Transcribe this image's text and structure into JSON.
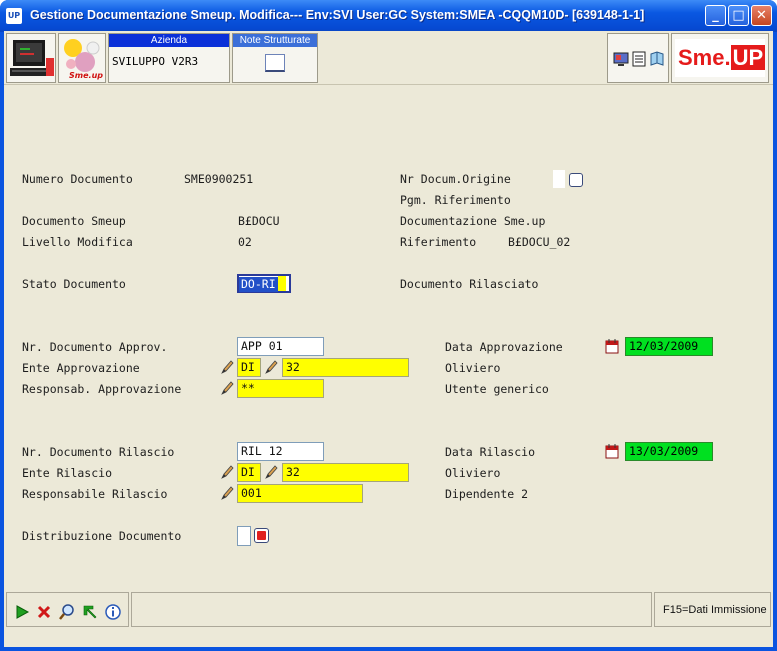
{
  "window": {
    "title": "Gestione Documentazione Smeup.  Modifica--- Env:SVI User:GC System:SMEA -CQQM10D- [639148-1-1]",
    "app_icon_text": "UP",
    "minimize": "_",
    "maximize": "□",
    "close": "✕"
  },
  "toolbar": {
    "azienda_header": "Azienda",
    "azienda_value": "SVILUPPO V2R3",
    "note_header": "Note Strutturate",
    "logo_text": "Sme.",
    "logo_up": "UP",
    "logo_small": "Sme.up"
  },
  "form": {
    "numero_documento_label": "Numero Documento",
    "numero_documento_value": "SME0900251",
    "documento_smeup_label": "Documento Smeup",
    "documento_smeup_value": "B£DOCU",
    "livello_modifica_label": "Livello Modifica",
    "livello_modifica_value": "02",
    "nr_docum_origine_label": "Nr Docum.Origine",
    "pgm_riferimento_label": "Pgm. Riferimento",
    "documentazione_label": "Documentazione Sme.up",
    "riferimento_label": "Riferimento",
    "riferimento_value": "B£DOCU_02",
    "stato_documento_label": "Stato Documento",
    "stato_documento_value": "DO-RI",
    "stato_documento_desc": "Documento Rilasciato",
    "approv": {
      "nr_label": "Nr. Documento Approv.",
      "nr_value": "APP 01",
      "ente_label": "Ente Approvazione",
      "ente_code": "DI",
      "ente_value": "32",
      "resp_label": "Responsab. Approvazione",
      "resp_value": "**",
      "data_label": "Data Approvazione",
      "data_value": "12/03/2009",
      "ente_desc": "Oliviero",
      "resp_desc": "Utente generico"
    },
    "rilascio": {
      "nr_label": "Nr. Documento Rilascio",
      "nr_value": "RIL 12",
      "ente_label": "Ente Rilascio",
      "ente_code": "DI",
      "ente_value": "32",
      "resp_label": "Responsabile Rilascio",
      "resp_value": "001",
      "data_label": "Data Rilascio",
      "data_value": "13/03/2009",
      "ente_desc": "Oliviero",
      "resp_desc": "Dipendente 2"
    },
    "distribuzione_label": "Distribuzione Documento"
  },
  "statusbar": {
    "function_key": "F15=Dati Immissione"
  },
  "colors": {
    "yellow_field": "#ffff00",
    "green_date": "#00e020",
    "selection": "#2250c8",
    "brand_red": "#e51b1b"
  }
}
